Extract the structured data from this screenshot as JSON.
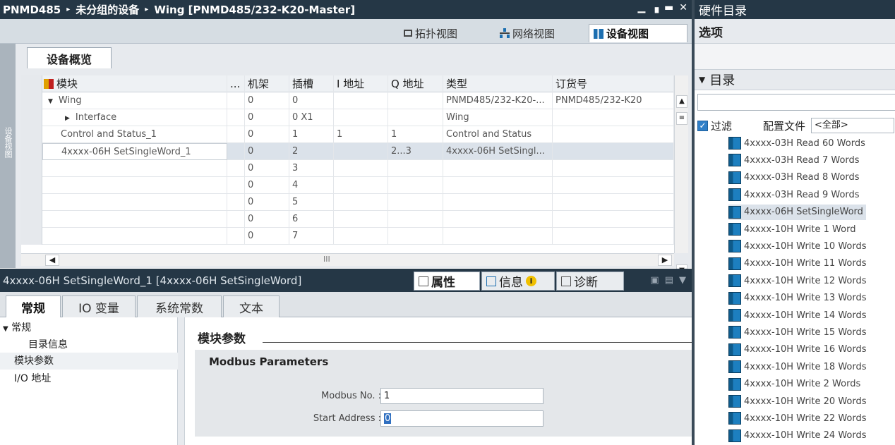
{
  "title_bar": {
    "crumbs": [
      "PNMD485",
      "未分组的设备",
      "Wing [PNMD485/232-K20-Master]"
    ],
    "separator": "▸",
    "controls": [
      "▁",
      "▗",
      "▬",
      "✕"
    ]
  },
  "view_tabs": [
    "拓扑视图",
    "网络视图",
    "设备视图"
  ],
  "left_strip_label": "设备视图",
  "overview_tab": "设备概览",
  "table": {
    "columns": [
      "模块",
      "...",
      "机架",
      "插槽",
      "I 地址",
      "Q 地址",
      "类型",
      "订货号"
    ],
    "rows": [
      {
        "module": "Wing",
        "expander": "▼",
        "rack": "0",
        "slot": "0",
        "i": "",
        "q": "",
        "type": "PNMD485/232-K20-...",
        "order": "PNMD485/232-K20"
      },
      {
        "module": "Interface",
        "expander": "▶",
        "rack": "0",
        "slot": "0 X1",
        "i": "",
        "q": "",
        "type": "Wing",
        "order": ""
      },
      {
        "module": "Control and Status_1",
        "expander": "",
        "rack": "0",
        "slot": "1",
        "i": "1",
        "q": "1",
        "type": "Control and Status",
        "order": ""
      },
      {
        "module": "4xxxx-06H SetSingleWord_1",
        "expander": "",
        "rack": "0",
        "slot": "2",
        "i": "",
        "q": "2...3",
        "type": "4xxxx-06H SetSingl...",
        "order": ""
      },
      {
        "module": "",
        "expander": "",
        "rack": "0",
        "slot": "3",
        "i": "",
        "q": "",
        "type": "",
        "order": ""
      },
      {
        "module": "",
        "expander": "",
        "rack": "0",
        "slot": "4",
        "i": "",
        "q": "",
        "type": "",
        "order": ""
      },
      {
        "module": "",
        "expander": "",
        "rack": "0",
        "slot": "5",
        "i": "",
        "q": "",
        "type": "",
        "order": ""
      },
      {
        "module": "",
        "expander": "",
        "rack": "0",
        "slot": "6",
        "i": "",
        "q": "",
        "type": "",
        "order": ""
      },
      {
        "module": "",
        "expander": "",
        "rack": "0",
        "slot": "7",
        "i": "",
        "q": "",
        "type": "",
        "order": ""
      }
    ],
    "scroll_mid": "III"
  },
  "props_bar": {
    "title": "4xxxx-06H SetSingleWord_1 [4xxxx-06H SetSingleWord]",
    "tabs": [
      "属性",
      "信息",
      "诊断"
    ],
    "info_badge": "i"
  },
  "sub_tabs": [
    "常规",
    "IO 变量",
    "系统常数",
    "文本"
  ],
  "nav": {
    "group": "常规",
    "catalog_info": "目录信息",
    "module_params": "模块参数",
    "io_address": "I/O 地址"
  },
  "content": {
    "section": "模块参数",
    "box_title": "Modbus Parameters",
    "fields": [
      {
        "label": "Modbus No. :",
        "value": "1"
      },
      {
        "label": "Start Address :",
        "value": "0"
      }
    ]
  },
  "hw_catalog": {
    "title": "硬件目录",
    "options": "选项",
    "catalog": "目录",
    "filter_label": "过滤",
    "profile_label": "配置文件",
    "profile_value": "<全部>",
    "items": [
      "4xxxx-03H Read 60 Words",
      "4xxxx-03H Read 7 Words",
      "4xxxx-03H Read 8 Words",
      "4xxxx-03H Read 9 Words",
      "4xxxx-06H SetSingleWord",
      "4xxxx-10H Write 1 Word",
      "4xxxx-10H Write 10 Words",
      "4xxxx-10H Write 11 Words",
      "4xxxx-10H Write 12 Words",
      "4xxxx-10H Write 13 Words",
      "4xxxx-10H Write 14 Words",
      "4xxxx-10H Write 15 Words",
      "4xxxx-10H Write 16 Words",
      "4xxxx-10H Write 18 Words",
      "4xxxx-10H Write 2 Words",
      "4xxxx-10H Write 20 Words",
      "4xxxx-10H Write 22 Words",
      "4xxxx-10H Write 24 Words"
    ]
  }
}
